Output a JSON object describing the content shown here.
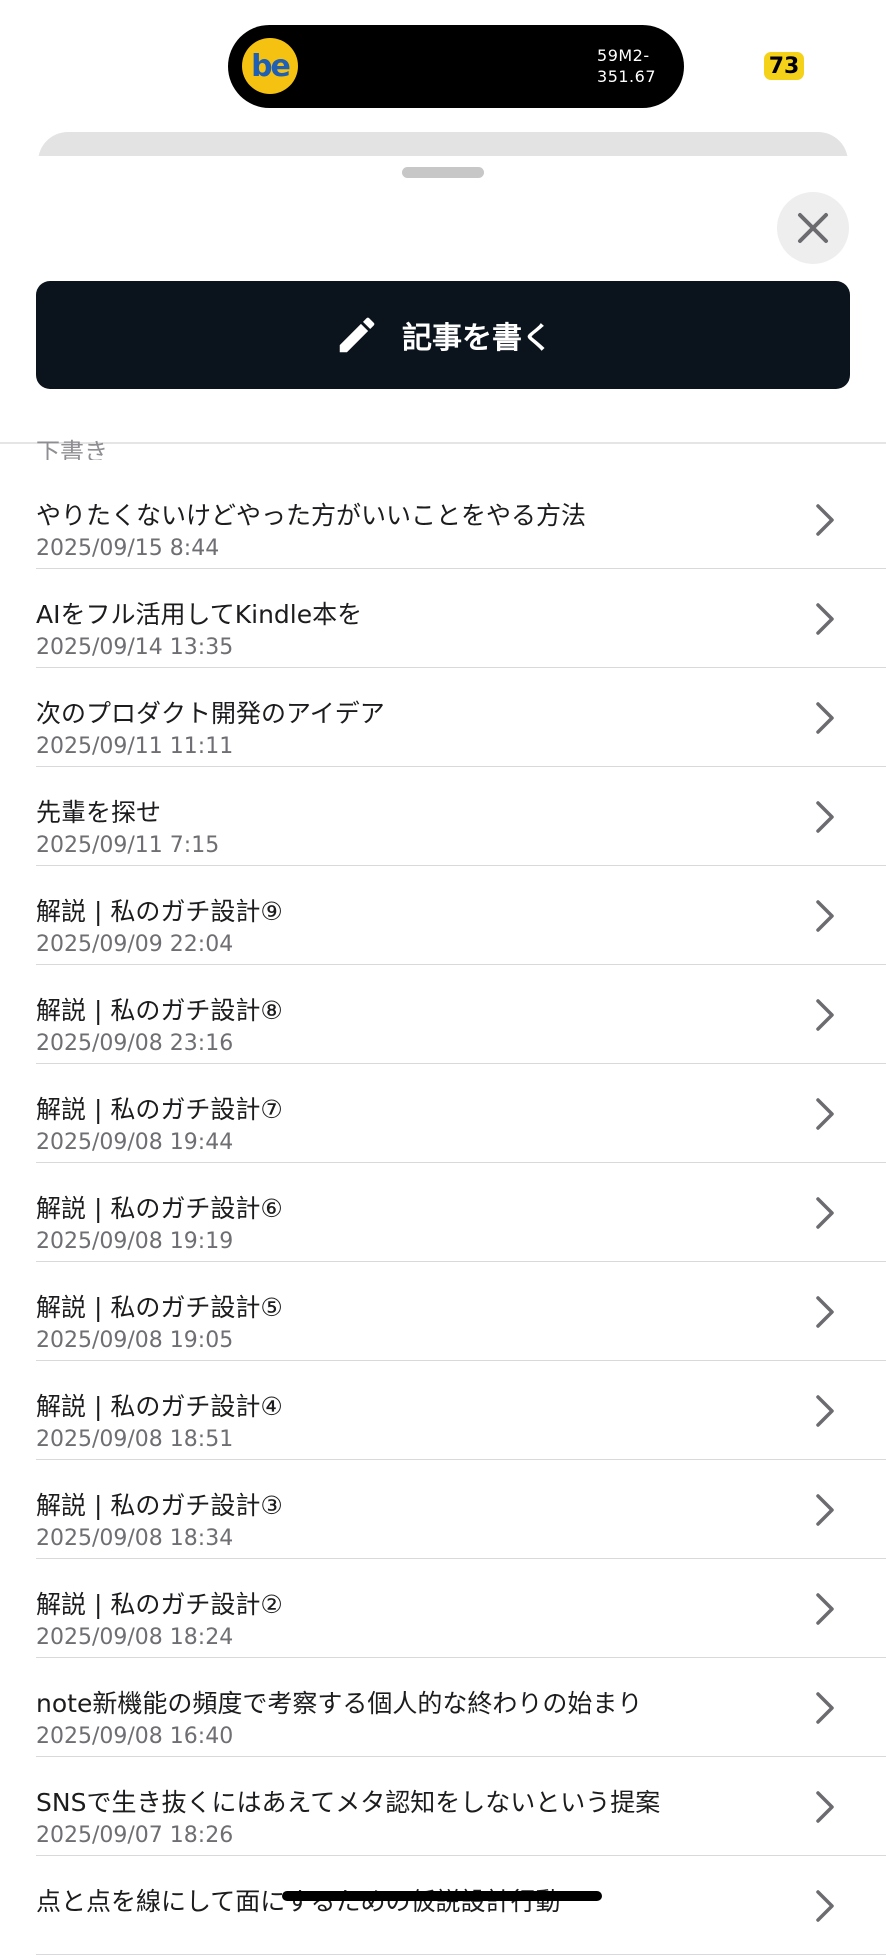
{
  "status": {
    "island_app": "be",
    "island_line1": "59M2-",
    "island_line2": "351.67",
    "battery": "73"
  },
  "sheet": {
    "close_icon": "close-icon",
    "write_button_label": "記事を書く",
    "write_icon": "pencil-icon",
    "section_title": "下書き"
  },
  "drafts": [
    {
      "title": "やりたくないけどやった方がいいことをやる方法",
      "date": "2025/09/15 8:44"
    },
    {
      "title": "AIをフル活用してKindle本を",
      "date": "2025/09/14 13:35"
    },
    {
      "title": "次のプロダクト開発のアイデア",
      "date": "2025/09/11 11:11"
    },
    {
      "title": "先輩を探せ",
      "date": "2025/09/11 7:15"
    },
    {
      "title": "解説 | 私のガチ設計⑨",
      "date": "2025/09/09 22:04"
    },
    {
      "title": "解説 | 私のガチ設計⑧",
      "date": "2025/09/08 23:16"
    },
    {
      "title": "解説 | 私のガチ設計⑦",
      "date": "2025/09/08 19:44"
    },
    {
      "title": "解説 | 私のガチ設計⑥",
      "date": "2025/09/08 19:19"
    },
    {
      "title": "解説 | 私のガチ設計⑤",
      "date": "2025/09/08 19:05"
    },
    {
      "title": "解説 | 私のガチ設計④",
      "date": "2025/09/08 18:51"
    },
    {
      "title": "解説 | 私のガチ設計③",
      "date": "2025/09/08 18:34"
    },
    {
      "title": "解説 | 私のガチ設計②",
      "date": "2025/09/08 18:24"
    },
    {
      "title": "note新機能の頻度で考察する個人的な終わりの始まり",
      "date": "2025/09/08 16:40"
    },
    {
      "title": "SNSで生き抜くにはあえてメタ認知をしないという提案",
      "date": "2025/09/07 18:26"
    },
    {
      "title": "点と点を線にして面にするための仮説設計行動",
      "date": ""
    }
  ]
}
